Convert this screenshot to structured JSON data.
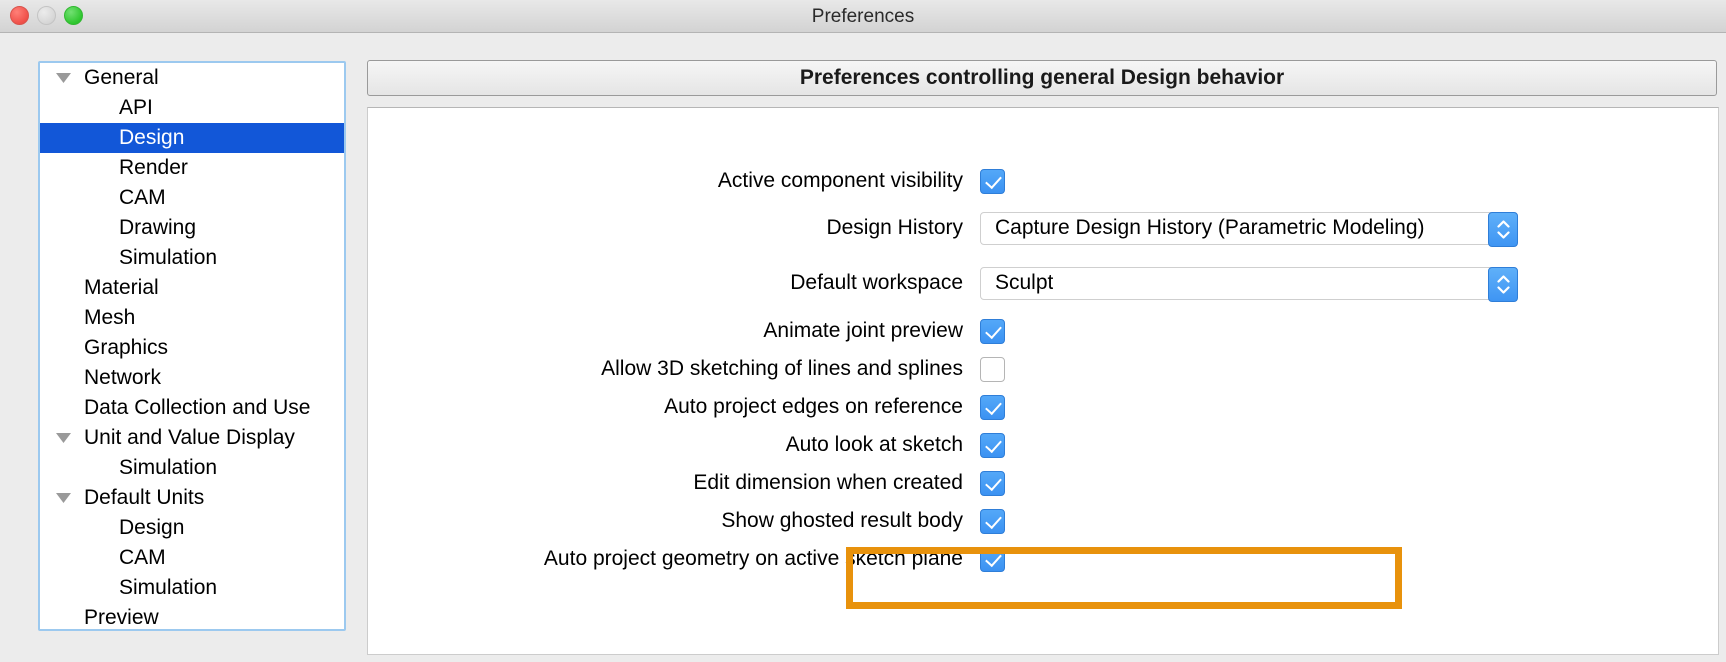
{
  "window": {
    "title": "Preferences",
    "traffic_lights": [
      "close",
      "minimize",
      "maximize"
    ]
  },
  "sidebar": {
    "items": [
      {
        "label": "General",
        "level": 0,
        "disclosure": true,
        "selected": false
      },
      {
        "label": "API",
        "level": 1,
        "disclosure": false,
        "selected": false
      },
      {
        "label": "Design",
        "level": 1,
        "disclosure": false,
        "selected": true
      },
      {
        "label": "Render",
        "level": 1,
        "disclosure": false,
        "selected": false
      },
      {
        "label": "CAM",
        "level": 1,
        "disclosure": false,
        "selected": false
      },
      {
        "label": "Drawing",
        "level": 1,
        "disclosure": false,
        "selected": false
      },
      {
        "label": "Simulation",
        "level": 1,
        "disclosure": false,
        "selected": false
      },
      {
        "label": "Material",
        "level": 0,
        "disclosure": false,
        "selected": false
      },
      {
        "label": "Mesh",
        "level": 0,
        "disclosure": false,
        "selected": false
      },
      {
        "label": "Graphics",
        "level": 0,
        "disclosure": false,
        "selected": false
      },
      {
        "label": "Network",
        "level": 0,
        "disclosure": false,
        "selected": false
      },
      {
        "label": "Data Collection and Use",
        "level": 0,
        "disclosure": false,
        "selected": false
      },
      {
        "label": "Unit and Value Display",
        "level": 0,
        "disclosure": true,
        "selected": false
      },
      {
        "label": "Simulation",
        "level": 1,
        "disclosure": false,
        "selected": false
      },
      {
        "label": "Default Units",
        "level": 0,
        "disclosure": true,
        "selected": false
      },
      {
        "label": "Design",
        "level": 1,
        "disclosure": false,
        "selected": false
      },
      {
        "label": "CAM",
        "level": 1,
        "disclosure": false,
        "selected": false
      },
      {
        "label": "Simulation",
        "level": 1,
        "disclosure": false,
        "selected": false
      },
      {
        "label": "Preview",
        "level": 0,
        "disclosure": false,
        "selected": false
      }
    ]
  },
  "main": {
    "header": "Preferences controlling general Design behavior",
    "rows": [
      {
        "label": "Active component visibility",
        "type": "checkbox",
        "checked": true
      },
      {
        "label": "Design History",
        "type": "popup",
        "value": "Capture Design History (Parametric Modeling)"
      },
      {
        "label": "Default workspace",
        "type": "popup",
        "value": "Sculpt"
      },
      {
        "label": "Animate joint preview",
        "type": "checkbox",
        "checked": true
      },
      {
        "label": "Allow 3D sketching of lines and splines",
        "type": "checkbox",
        "checked": false
      },
      {
        "label": "Auto project edges on reference",
        "type": "checkbox",
        "checked": true
      },
      {
        "label": "Auto look at sketch",
        "type": "checkbox",
        "checked": true
      },
      {
        "label": "Edit dimension when created",
        "type": "checkbox",
        "checked": true
      },
      {
        "label": "Show ghosted result body",
        "type": "checkbox",
        "checked": true
      },
      {
        "label": "Auto project geometry on active sketch plane",
        "type": "checkbox",
        "checked": true
      }
    ]
  },
  "annotation": {
    "highlight_color": "#e8920c",
    "highlighted_row_label": "Auto project geometry on active sketch plane"
  },
  "colors": {
    "selection_blue": "#1257d8",
    "checkbox_blue": "#3b92f2",
    "stepper_blue": "#3f95f3",
    "sidebar_focus_ring": "#9cc9ef",
    "highlight_orange": "#e8920c"
  }
}
